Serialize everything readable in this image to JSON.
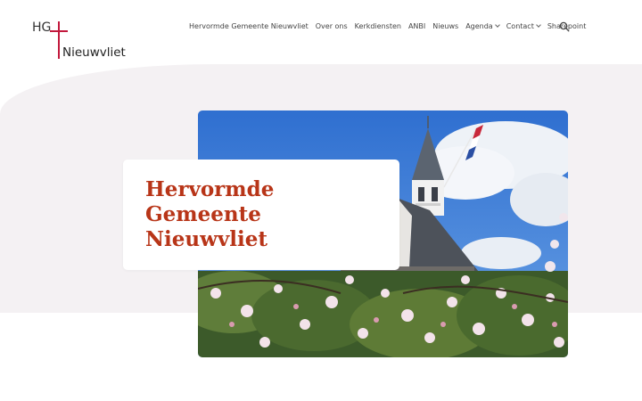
{
  "logo": {
    "initials": "HG",
    "name": "Nieuwvliet"
  },
  "nav": {
    "items": [
      {
        "label": "Hervormde Gemeente Nieuwvliet",
        "has_dropdown": false
      },
      {
        "label": "Over ons",
        "has_dropdown": false
      },
      {
        "label": "Kerkdiensten",
        "has_dropdown": false
      },
      {
        "label": "ANBI",
        "has_dropdown": false
      },
      {
        "label": "Nieuws",
        "has_dropdown": false
      },
      {
        "label": "Agenda",
        "has_dropdown": true
      },
      {
        "label": "Contact",
        "has_dropdown": true
      },
      {
        "label": "Sharepoint",
        "has_dropdown": false
      }
    ],
    "search_icon": "search-icon"
  },
  "hero": {
    "title_lines": [
      "Hervormde",
      "Gemeente",
      "Nieuwvliet"
    ]
  },
  "colors": {
    "title": "#b83518",
    "cross": "#c2183c",
    "band": "#f4f1f3",
    "sky": "#3f7fd6"
  }
}
